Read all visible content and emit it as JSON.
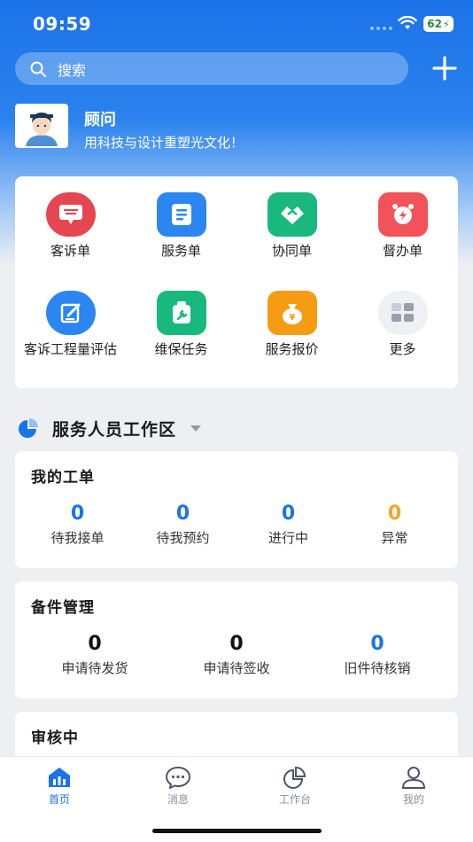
{
  "status": {
    "time": "09:59",
    "battery": "62"
  },
  "search": {
    "placeholder": "搜索"
  },
  "profile": {
    "name": "顾问",
    "motto": "用科技与设计重塑光文化！"
  },
  "grid": [
    {
      "label": "客诉单",
      "icon": "complaint-icon",
      "color": "#e4474f"
    },
    {
      "label": "服务单",
      "icon": "service-order-icon",
      "color": "#2b86f2"
    },
    {
      "label": "协同单",
      "icon": "handshake-icon",
      "color": "#19b87e"
    },
    {
      "label": "督办单",
      "icon": "alarm-clock-icon",
      "color": "#f2525a"
    },
    {
      "label": "客诉工程量评估",
      "icon": "evaluation-icon",
      "color": "#2b86f2"
    },
    {
      "label": "维保任务",
      "icon": "maintenance-icon",
      "color": "#19b87e"
    },
    {
      "label": "服务报价",
      "icon": "money-bag-icon",
      "color": "#f59c12"
    },
    {
      "label": "更多",
      "icon": "more-grid-icon",
      "color": "#eef0f4"
    }
  ],
  "workspace": {
    "title": "服务人员工作区"
  },
  "orders": {
    "title": "我的工单",
    "stats": [
      {
        "value": "0",
        "label": "待我接单",
        "color": "#1b73e8"
      },
      {
        "value": "0",
        "label": "待我预约",
        "color": "#1b73e8"
      },
      {
        "value": "0",
        "label": "进行中",
        "color": "#1b73e8"
      },
      {
        "value": "0",
        "label": "异常",
        "color": "#f5a623"
      }
    ]
  },
  "parts": {
    "title": "备件管理",
    "stats": [
      {
        "value": "0",
        "label": "申请待发货",
        "color": "#111111"
      },
      {
        "value": "0",
        "label": "申请待签收",
        "color": "#111111"
      },
      {
        "value": "0",
        "label": "旧件待核销",
        "color": "#1b73e8"
      }
    ]
  },
  "review": {
    "title": "审核中"
  },
  "tabs": [
    {
      "label": "首页",
      "icon": "home-icon",
      "active": true
    },
    {
      "label": "消息",
      "icon": "message-icon",
      "active": false
    },
    {
      "label": "工作台",
      "icon": "workbench-icon",
      "active": false
    },
    {
      "label": "我的",
      "icon": "profile-icon",
      "active": false
    }
  ]
}
